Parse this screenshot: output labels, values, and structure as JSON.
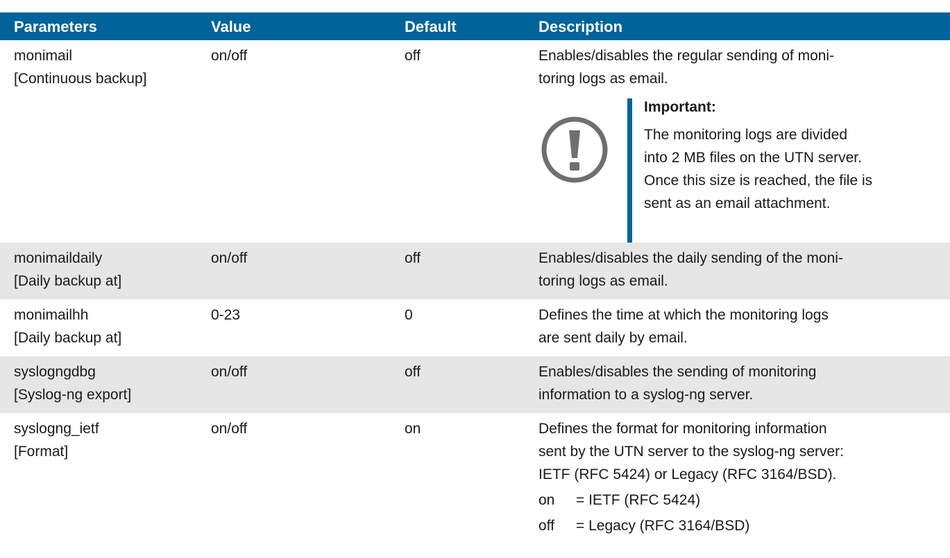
{
  "headers": {
    "parameters": "Parameters",
    "value": "Value",
    "default": "Default",
    "description": "Description"
  },
  "rows": [
    {
      "param": "monimail",
      "label": "[Continuous backup]",
      "value": "on/off",
      "default": "off",
      "description": [
        "Enables/disables the regular sending of moni-",
        "toring logs as email."
      ],
      "note": {
        "icon": "exclamation-circle-icon",
        "title": "Important:",
        "text": [
          "The monitoring logs are divided",
          "into 2 MB files on the UTN server.",
          "Once this size is reached, the file is",
          "sent as an email attachment."
        ]
      }
    },
    {
      "param": "monimaildaily",
      "label": "[Daily backup at]",
      "value": "on/off",
      "default": "off",
      "description": [
        "Enables/disables the daily sending of the moni-",
        "toring logs as email."
      ]
    },
    {
      "param": "monimailhh",
      "label": "[Daily backup at]",
      "value": "0-23",
      "default": "0",
      "description": [
        "Defines the time at which the monitoring logs",
        "are sent daily by email."
      ]
    },
    {
      "param": "syslogngdbg",
      "label": "[Syslog-ng export]",
      "value": "on/off",
      "default": "off",
      "description": [
        "Enables/disables the sending of monitoring",
        "information to a syslog-ng server."
      ]
    },
    {
      "param": "syslogng_ietf",
      "label": "[Format]",
      "value": "on/off",
      "default": "on",
      "description": [
        "Defines the format for monitoring information",
        "sent by the UTN server to the syslog-ng server:",
        "IETF (RFC 5424) or Legacy (RFC 3164/BSD)."
      ],
      "options": [
        {
          "key": "on",
          "value": "= IETF (RFC 5424)"
        },
        {
          "key": "off",
          "value": "= Legacy (RFC 3164/BSD)"
        }
      ]
    }
  ],
  "colors": {
    "header_bg": "#00639a",
    "row_shade": "#e6e6e6",
    "icon": "#6f6f6f"
  }
}
